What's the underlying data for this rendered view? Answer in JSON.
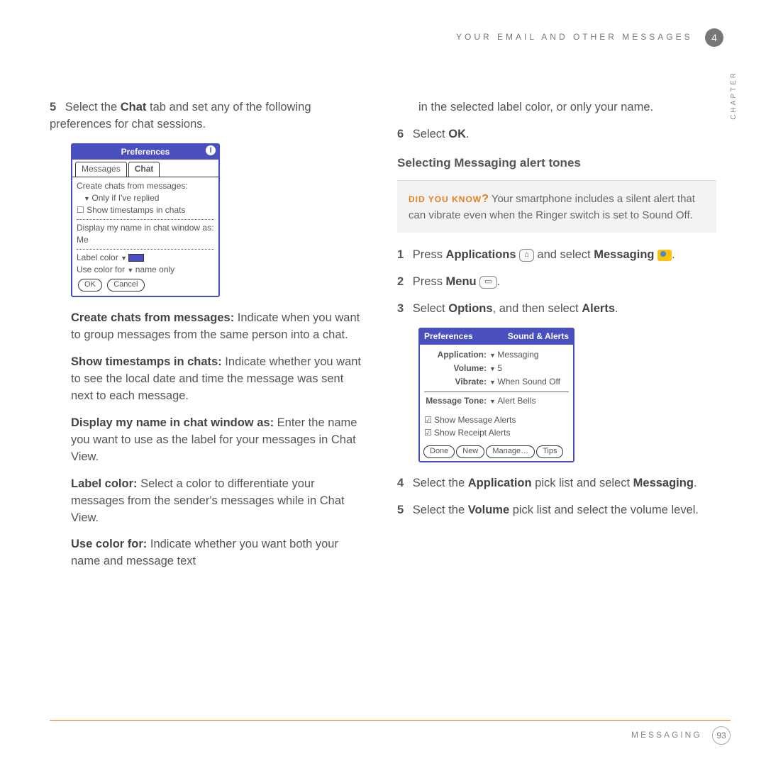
{
  "header": {
    "section": "YOUR EMAIL AND OTHER MESSAGES",
    "chapter_num": "4",
    "chapter_label": "CHAPTER"
  },
  "footer": {
    "label": "MESSAGING",
    "page": "93"
  },
  "left": {
    "step5": {
      "num": "5",
      "text_pre": "Select the ",
      "bold1": "Chat",
      "text_post": " tab and set any of the following preferences for chat sessions."
    },
    "mock1": {
      "title": "Preferences",
      "tab1": "Messages",
      "tab2": "Chat",
      "create": "Create chats from messages:",
      "only": "Only if I've replied",
      "timestamps": "Show timestamps in chats",
      "displayname": "Display my name in chat window as:",
      "me": "Me",
      "labelcolor": "Label color",
      "usecolor": "Use color for",
      "nameonly": "name only",
      "ok": "OK",
      "cancel": "Cancel"
    },
    "p1": {
      "b": "Create chats from messages:",
      "t": " Indicate when you want to group messages from the same person into a chat."
    },
    "p2": {
      "b": "Show timestamps in chats:",
      "t": " Indicate whether you want to see the local date and time the message was sent next to each message."
    },
    "p3": {
      "b": "Display my name in chat window as:",
      "t": " Enter the name you want to use as the label for your messages in Chat View."
    },
    "p4": {
      "b": "Label color:",
      "t": " Select a color to differentiate your messages from the sender's messages while in Chat View."
    },
    "p5": {
      "b": "Use color for:",
      "t": " Indicate whether you want both your name and message text"
    }
  },
  "right": {
    "cont": "in the selected label color, or only your name.",
    "step6": {
      "num": "6",
      "pre": "Select ",
      "b": "OK",
      "post": "."
    },
    "heading": "Selecting Messaging alert tones",
    "tip": {
      "label": "DID YOU KNOW",
      "q": "?",
      "text": " Your smartphone includes a silent alert that can vibrate even when the Ringer switch is set to Sound Off."
    },
    "r1": {
      "num": "1",
      "pre": "Press ",
      "b1": "Applications",
      "mid": " and select ",
      "b2": "Messaging",
      "post": "."
    },
    "r2": {
      "num": "2",
      "pre": "Press ",
      "b": "Menu",
      "post": "."
    },
    "r3": {
      "num": "3",
      "pre": "Select ",
      "b1": "Options",
      "mid": ", and then select ",
      "b2": "Alerts",
      "post": "."
    },
    "mock2": {
      "title": "Preferences",
      "subtitle": "Sound & Alerts",
      "app_l": "Application:",
      "app_v": "Messaging",
      "vol_l": "Volume:",
      "vol_v": "5",
      "vib_l": "Vibrate:",
      "vib_v": "When Sound Off",
      "tone_l": "Message Tone:",
      "tone_v": "Alert Bells",
      "chk1": "Show Message Alerts",
      "chk2": "Show Receipt Alerts",
      "b1": "Done",
      "b2": "New",
      "b3": "Manage…",
      "b4": "Tips"
    },
    "r4": {
      "num": "4",
      "pre": "Select the ",
      "b1": "Application",
      "mid": " pick list and select ",
      "b2": "Messaging",
      "post": "."
    },
    "r5": {
      "num": "5",
      "pre": "Select the ",
      "b1": "Volume",
      "mid": " pick list and select the volume level.",
      "post": ""
    }
  }
}
